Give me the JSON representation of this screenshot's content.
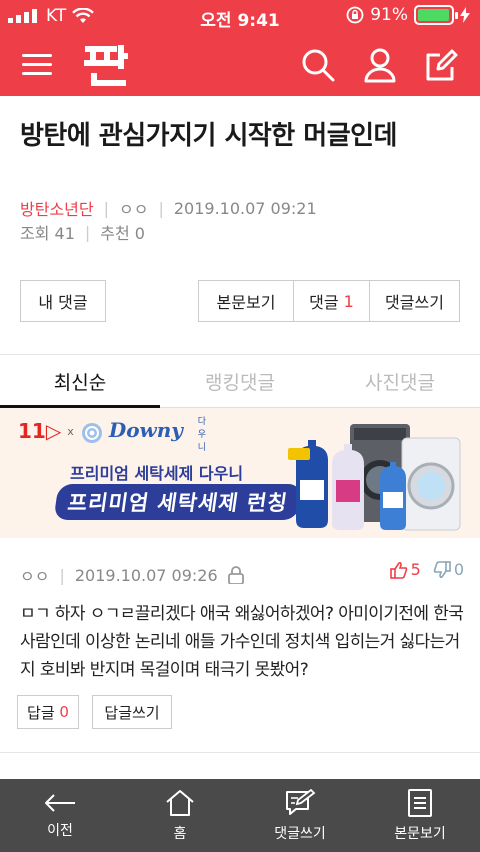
{
  "status_bar": {
    "carrier": "KT",
    "time": "오전 9:41",
    "battery": "91%"
  },
  "app": {
    "logo_text": "판"
  },
  "post": {
    "title": "방탄에 관심가지기 시작한 머글인데",
    "category": "방탄소년단",
    "author": "ㅇㅇ",
    "datetime": "2019.10.07 09:21",
    "views": "조회 41",
    "recommends": "추천 0"
  },
  "buttons": {
    "my_comments": "내 댓글",
    "view_post": "본문보기",
    "comments_label": "댓글",
    "comments_count": "1",
    "write_comment": "댓글쓰기"
  },
  "tabs": [
    {
      "label": "최신순",
      "active": true
    },
    {
      "label": "랭킹댓글",
      "active": false
    },
    {
      "label": "사진댓글",
      "active": false
    }
  ],
  "ad": {
    "partner": "11",
    "x": "x",
    "brand": "Downy",
    "brand_ko": "다우니",
    "line1": "프리미엄 세탁세제 다우니",
    "line2": "프리미엄 세탁세제 런칭"
  },
  "comment": {
    "author": "ㅇㅇ",
    "datetime": "2019.10.07 09:26",
    "upvotes": "5",
    "downvotes": "0",
    "body": "ㅁㄱ 하자 ㅇㄱㄹ끌리겠다 애국 왜싫어하겠어? 아미이기전에 한국사람인데 이상한 논리네 애들 가수인데 정치색 입히는거 싫다는거지 호비봐 반지며 목걸이며 태극기 못봤어?",
    "reply_label": "답글",
    "reply_count": "0",
    "write_reply": "답글쓰기"
  },
  "bottom_nav": [
    {
      "label": "이전",
      "icon": "back-arrow-icon"
    },
    {
      "label": "홈",
      "icon": "home-icon"
    },
    {
      "label": "댓글쓰기",
      "icon": "write-comment-icon"
    },
    {
      "label": "본문보기",
      "icon": "document-icon"
    }
  ],
  "colors": {
    "brand_red": "#ee3f48",
    "nav_bg": "#4a4a4a",
    "ad_bg": "#fdf3ea"
  }
}
